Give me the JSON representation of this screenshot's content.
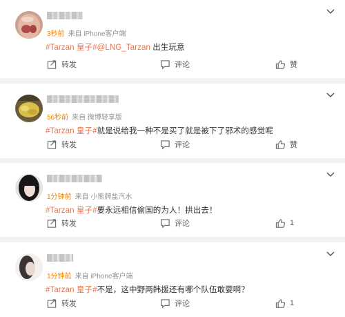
{
  "colors": {
    "link": "#eb7350",
    "time": "#f08300",
    "meta": "#939393",
    "background": "#f2f2f2"
  },
  "action_labels": {
    "forward": "转发",
    "comment": "评论"
  },
  "comments": [
    {
      "time": "3秒前",
      "source": "来自 iPhone客户端",
      "hashtag": "#Tarzan 皇子#",
      "mention": "@LNG_Tarzan",
      "text": " 出生玩意",
      "like_label": "赞"
    },
    {
      "time": "56秒前",
      "source": "来自 微博轻享版",
      "hashtag": "#Tarzan 皇子#",
      "mention": "",
      "text": "就是说给我一种不是买了就是被下了邪术的感觉呢",
      "like_label": "赞"
    },
    {
      "time": "1分钟前",
      "source": "来自 小熊牌盐汽水",
      "hashtag": "#Tarzan 皇子#",
      "mention": "",
      "text": "要永远相信偷国的为人！拱出去！",
      "like_label": "1"
    },
    {
      "time": "1分钟前",
      "source": "来自 iPhone客户端",
      "hashtag": "#Tarzan 皇子#",
      "mention": "",
      "text": "不是，这中野两韩援还有哪个队伍敢要啊？",
      "like_label": "1"
    }
  ]
}
